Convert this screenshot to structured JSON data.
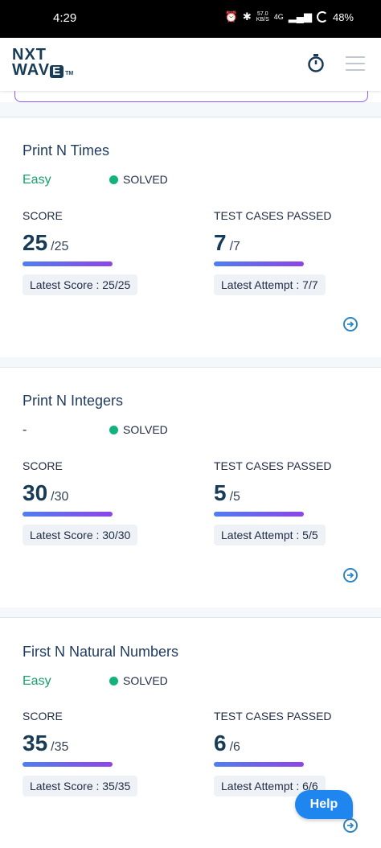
{
  "status_bar": {
    "time": "4:29",
    "speed_value": "57.0",
    "speed_unit": "KB/S",
    "network": "4G",
    "battery": "48%"
  },
  "header": {
    "logo_line1": "NXT",
    "logo_line2": "WAV",
    "logo_e": "E",
    "logo_tm": "TM"
  },
  "labels": {
    "score": "SCORE",
    "test_cases": "TEST CASES PASSED"
  },
  "problems": [
    {
      "title": "Print N Times",
      "difficulty": "Easy",
      "status": "SOLVED",
      "score": "25",
      "score_total": "/25",
      "tests": "7",
      "tests_total": "/7",
      "latest_score": "Latest Score : 25/25",
      "latest_attempt": "Latest Attempt : 7/7"
    },
    {
      "title": "Print N Integers",
      "difficulty": "-",
      "status": "SOLVED",
      "score": "30",
      "score_total": "/30",
      "tests": "5",
      "tests_total": "/5",
      "latest_score": "Latest Score : 30/30",
      "latest_attempt": "Latest Attempt : 5/5"
    },
    {
      "title": "First N Natural Numbers",
      "difficulty": "Easy",
      "status": "SOLVED",
      "score": "35",
      "score_total": "/35",
      "tests": "6",
      "tests_total": "/6",
      "latest_score": "Latest Score : 35/35",
      "latest_attempt": "Latest Attempt : 6/6"
    }
  ],
  "help_button": "Help",
  "colors": {
    "easy": "#18a070",
    "solved_dot": "#12b27c",
    "accent_blue": "#1f86f0",
    "title": "#1f3a5f"
  }
}
